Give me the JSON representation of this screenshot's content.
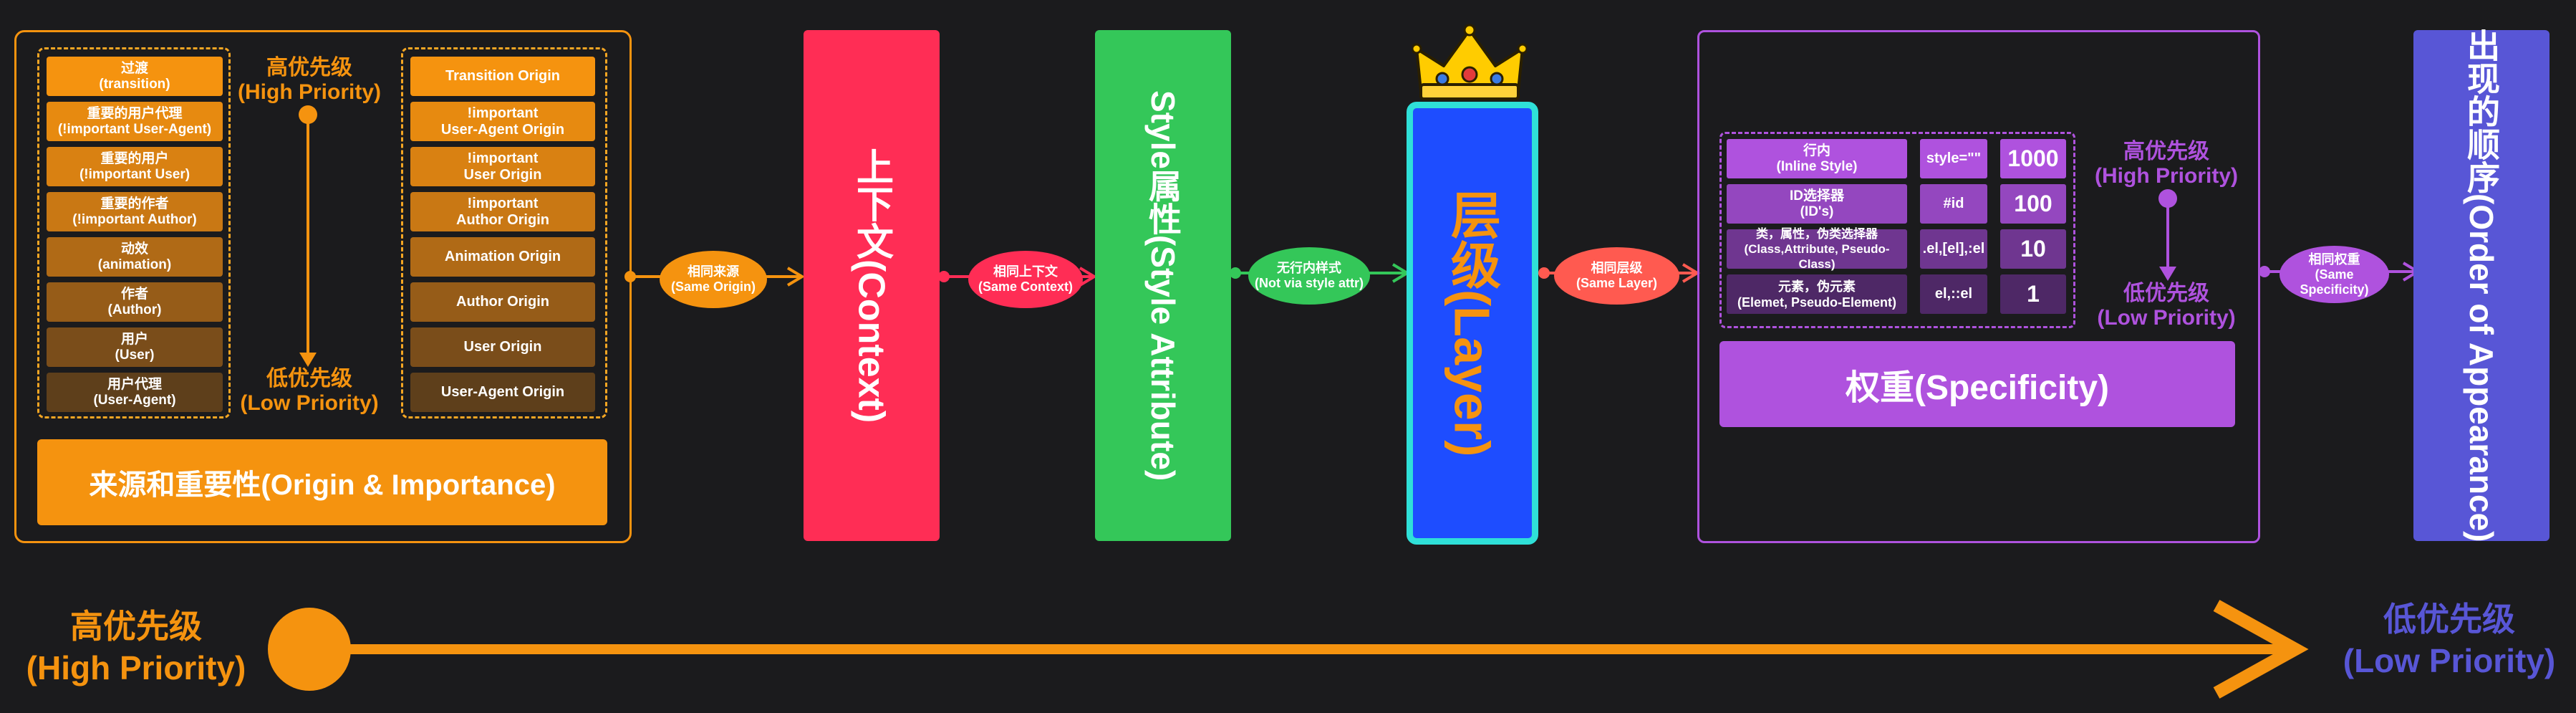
{
  "colors": {
    "background": "#1b1b1d",
    "orange": "#f5930f",
    "red": "#ff2d55",
    "green": "#34c759",
    "blue": "#1e4dff",
    "cyan": "#2fe0d8",
    "purple": "#af52de",
    "indigo": "#5856d6"
  },
  "origin": {
    "title": "来源和重要性(Origin & Importance)",
    "left_items": [
      "过渡\n(transition)",
      "重要的用户代理\n(!important User-Agent)",
      "重要的用户\n(!important User)",
      "重要的作者\n(!important Author)",
      "动效\n(animation)",
      "作者\n(Author)",
      "用户\n(User)",
      "用户代理\n(User-Agent)"
    ],
    "right_items": [
      "Transition Origin",
      "!important\nUser-Agent Origin",
      "!important\nUser Origin",
      "!important\nAuthor Origin",
      "Animation Origin",
      "Author Origin",
      "User Origin",
      "User-Agent Origin"
    ],
    "high": "高优先级\n(High Priority)",
    "low": "低优先级\n(Low Priority)"
  },
  "connectors": {
    "same_origin": "相同来源\n(Same Origin)",
    "same_context": "相同上下文\n(Same Context)",
    "no_style_attr": "无行内样式\n(Not via style attr)",
    "same_layer": "相同层级\n(Same Layer)",
    "same_specificity": "相同权重\n(Same Specificity)"
  },
  "stages": {
    "context": "上下文(Context)",
    "style_attribute": "Style属性(Style Attribute)",
    "layer": "层级(Layer)",
    "order": "出现的顺序(Order of Appearance)",
    "crown_icon": "crown-icon"
  },
  "specificity": {
    "title": "权重(Specificity)",
    "rows": [
      {
        "label": "行内\n(Inline Style)",
        "example": "style=\"\"",
        "value": "1000"
      },
      {
        "label": "ID选择器\n(ID's)",
        "example": "#id",
        "value": "100"
      },
      {
        "label": "类，属性，伪类选择器\n(Class,Attribute, Pseudo-Class)",
        "example": ".el,[el],:el",
        "value": "10"
      },
      {
        "label": "元素，伪元素\n(Elemet, Pseudo-Element)",
        "example": "el,::el",
        "value": "1"
      }
    ],
    "high": "高优先级\n(High Priority)",
    "low": "低优先级\n(Low Priority)"
  },
  "bottom": {
    "high": "高优先级\n(High Priority)",
    "low": "低优先级\n(Low Priority)"
  }
}
